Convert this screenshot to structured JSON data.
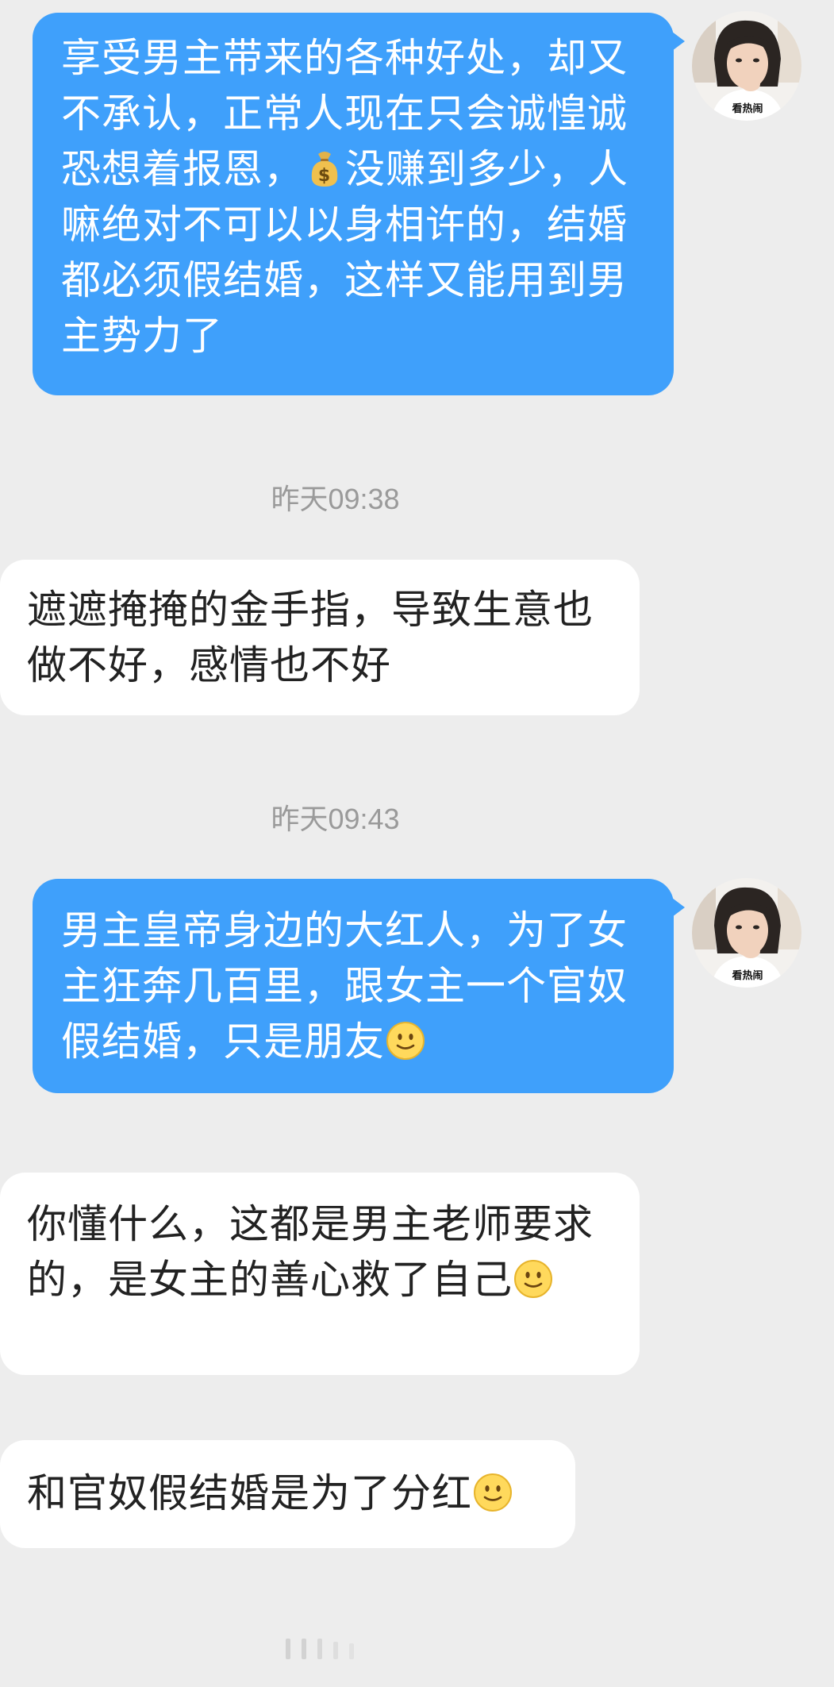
{
  "messages": [
    {
      "direction": "outgoing",
      "text_before_emoji": "享受男主带来的各种好处，却又不承认，正常人现在只会诚惶诚恐想着报恩，",
      "emoji": "money-bag",
      "text_after_emoji": "没赚到多少，人嘛绝对不可以以身相许的，结婚都必须假结婚，这样又能用到男主势力了",
      "avatar_caption": "看热闹"
    },
    {
      "timestamp": "昨天09:38"
    },
    {
      "direction": "incoming",
      "text": "遮遮掩掩的金手指，导致生意也做不好，感情也不好"
    },
    {
      "timestamp": "昨天09:43"
    },
    {
      "direction": "outgoing",
      "text": "男主皇帝身边的大红人，为了女主狂奔几百里，跟女主一个官奴假结婚，只是朋友",
      "emoji": "slight-smile",
      "avatar_caption": "看热闹"
    },
    {
      "direction": "incoming",
      "text": "你懂什么，这都是男主老师要求的，是女主的善心救了自己",
      "emoji": "slight-smile"
    },
    {
      "direction": "incoming",
      "text": "和官奴假结婚是为了分红",
      "emoji": "slight-smile"
    }
  ],
  "colors": {
    "background": "#ededed",
    "outgoing_bubble": "#3fa0fb",
    "incoming_bubble": "#ffffff",
    "timestamp_text": "#9a9a9a"
  },
  "icons": {
    "money_bag": "money-bag-icon",
    "smile": "slight-smile-icon",
    "avatar": "avatar-image"
  }
}
